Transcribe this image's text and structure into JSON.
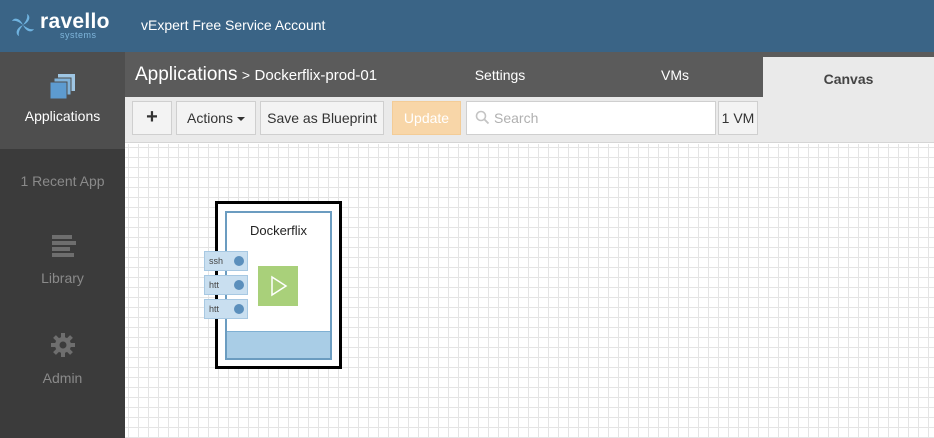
{
  "brand": {
    "name": "ravello",
    "sub": "systems"
  },
  "account": "vExpert Free Service Account",
  "sidebar": {
    "items": [
      {
        "label": "Applications",
        "icon": "applications-icon",
        "active": true
      },
      {
        "label": "1 Recent App",
        "icon": "",
        "active": false
      },
      {
        "label": "Library",
        "icon": "library-icon",
        "active": false
      },
      {
        "label": "Admin",
        "icon": "gear-icon",
        "active": false
      }
    ]
  },
  "header": {
    "breadcrumb_main": "Applications",
    "breadcrumb_sep": ">",
    "breadcrumb_app": "Dockerflix-prod-01",
    "tabs": [
      {
        "label": "Settings",
        "active": false
      },
      {
        "label": "VMs",
        "active": false
      },
      {
        "label": "Canvas",
        "active": true
      }
    ]
  },
  "toolbar": {
    "add_label": "+",
    "actions_label": "Actions",
    "blueprint_label": "Save as Blueprint",
    "update_label": "Update",
    "search_placeholder": "Search",
    "search_value": "",
    "vm_count": "1 VM"
  },
  "canvas": {
    "vm": {
      "name": "Dockerflix",
      "services": [
        "ssh",
        "htt",
        "htt"
      ]
    }
  },
  "colors": {
    "topbar": "#3a6486",
    "sidebar": "#3b3b3b",
    "header": "#5b5b5b",
    "update_button": "#f8d6a8",
    "vm_play": "#a9d07a",
    "vm_footer": "#a9cde6"
  }
}
